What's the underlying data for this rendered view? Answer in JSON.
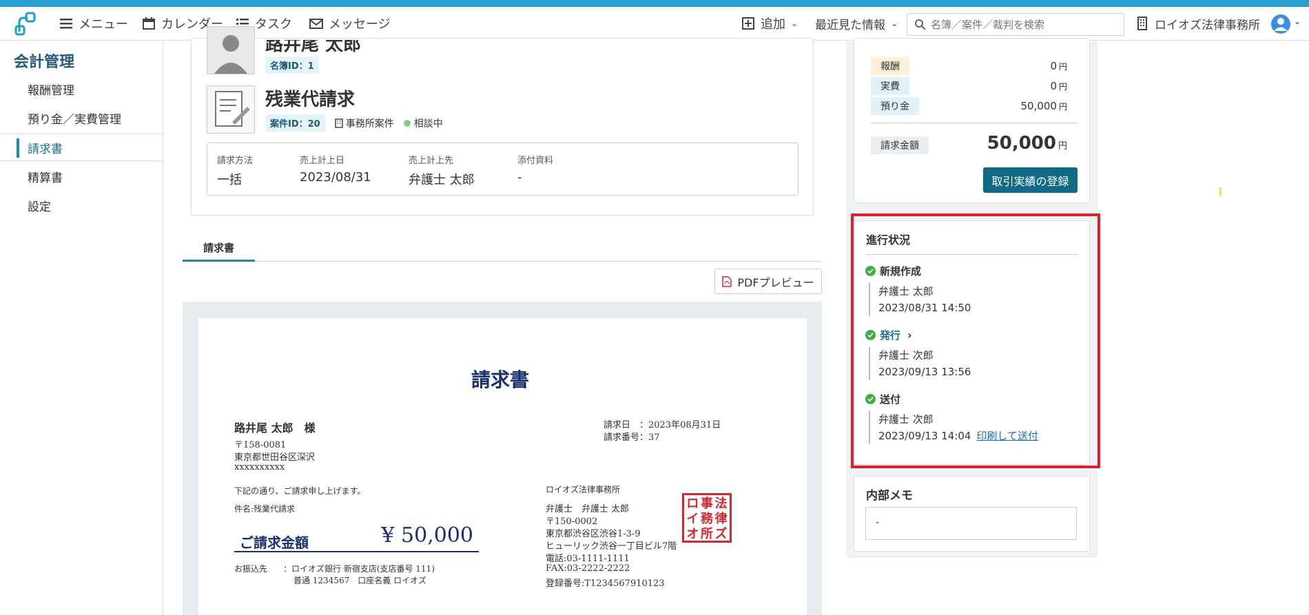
{
  "nav": {
    "menu": "メニュー",
    "calendar": "カレンダー",
    "task": "タスク",
    "message": "メッセージ",
    "add": "追加",
    "recent": "最近見た情報",
    "search_placeholder": "名簿／案件／裁判を検索",
    "firm": "ロイオズ法律事務所"
  },
  "sidebar": {
    "title": "会計管理",
    "items": [
      {
        "label": "報酬管理"
      },
      {
        "label": "預り金／実費管理"
      },
      {
        "label": "請求書"
      },
      {
        "label": "精算書"
      },
      {
        "label": "設定"
      }
    ]
  },
  "client": {
    "name": "路井尾 太郎",
    "meibo_id": "名簿ID：1"
  },
  "case": {
    "title": "残業代請求",
    "case_id": "案件ID：20",
    "office": "事務所案件",
    "status": "相談中"
  },
  "info": {
    "method_label": "請求方法",
    "method": "一括",
    "date_label": "売上計上日",
    "date": "2023/08/31",
    "dest_label": "売上計上先",
    "dest": "弁護士 太郎",
    "attach_label": "添付資料",
    "attach": "-"
  },
  "tabs": {
    "invoice": "請求書"
  },
  "pdf_button": "PDFプレビュー",
  "invoice": {
    "title": "請求書",
    "to": "路井尾 太郎　様",
    "zip": "〒158-0081",
    "address": "東京都世田谷区深沢",
    "address2": "xxxxxxxxxx",
    "date": "請求日　：2023年08月31日",
    "number": "請求番号：37",
    "note": "下記の通り、ご請求申し上げます。",
    "subject": "件名:残業代請求",
    "amount_label": "ご請求金額",
    "amount": "¥ 50,000",
    "bank_label": "お振込先",
    "bank1": "：ロイオズ銀行 新宿支店(支店番号 111)",
    "bank2": "普通 1234567　口座名義 ロイオズ",
    "firm": "ロイオズ法律事務所",
    "lawyer": "弁護士　弁護士 太郎",
    "firm_zip": "〒150-0002",
    "firm_addr": "東京都渋谷区渋谷1-3-9",
    "firm_bldg": "ヒューリック渋谷一丁目ビル7階",
    "tel": "電話:03-1111-1111",
    "fax": "FAX:03-2222-2222",
    "reg": "登録番号:T1234567910123",
    "seal_text": "法律事務所ロイオズ"
  },
  "amounts": {
    "fee_label": "報酬",
    "fee": "0",
    "fee_unit": "円",
    "expense_label": "実費",
    "expense": "0",
    "expense_unit": "円",
    "deposit_label": "預り金",
    "deposit": "50,000",
    "deposit_unit": "円",
    "total_label": "請求金額",
    "total": "50,000",
    "total_unit": "円"
  },
  "register_button": "取引実績の登録",
  "progress": {
    "title": "進行状況",
    "steps": [
      {
        "label": "新規作成",
        "person": "弁護士 太郎",
        "time": "2023/08/31 14:50"
      },
      {
        "label": "発行",
        "person": "弁護士 次郎",
        "time": "2023/09/13 13:56"
      },
      {
        "label": "送付",
        "person": "弁護士 次郎",
        "time": "2023/09/13 14:04",
        "link": "印刷して送付"
      }
    ]
  },
  "memo": {
    "title": "内部メモ",
    "value": "-"
  }
}
